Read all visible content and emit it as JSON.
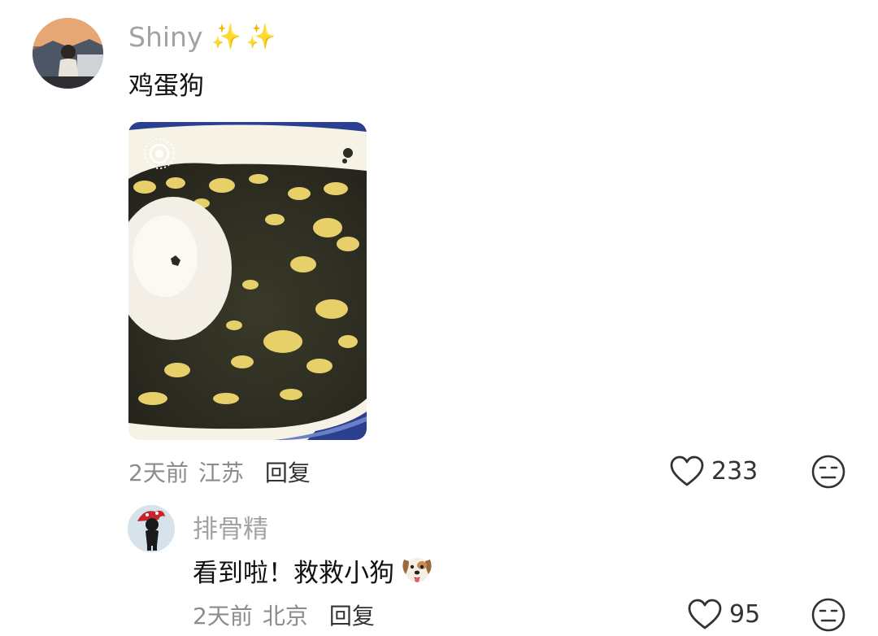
{
  "comment": {
    "username": "Shiny",
    "sparkles": "✨ ✨",
    "text": "鸡蛋狗",
    "time": "2天前",
    "location": "江苏",
    "reply_label": "回复",
    "like_count": "233",
    "like_icon": "heart-outline-icon",
    "dislike_icon": "neutral-face-icon",
    "photo_badge_icon": "live-photo-icon"
  },
  "reply": {
    "username": "排骨精",
    "text": "看到啦！救救小狗",
    "emoji": "dog-face-emoji",
    "time": "2天前",
    "location": "北京",
    "reply_label": "回复",
    "like_count": "95",
    "like_icon": "heart-outline-icon",
    "dislike_icon": "neutral-face-icon"
  }
}
